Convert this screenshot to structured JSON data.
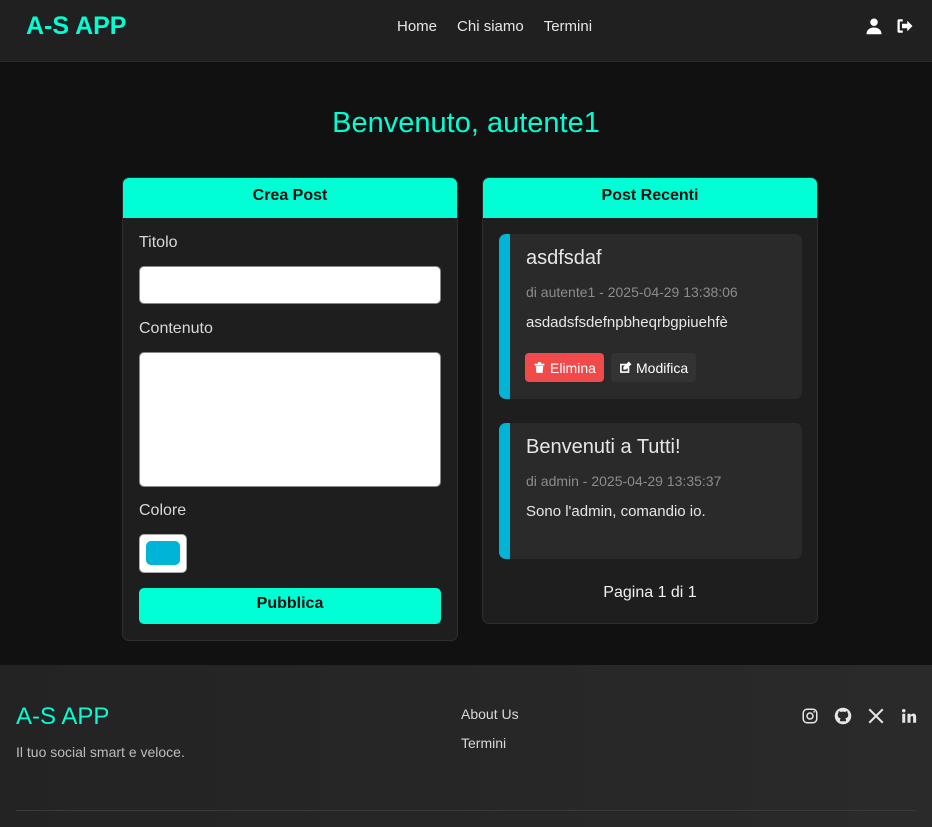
{
  "navbar": {
    "brand": "A-S APP",
    "links": [
      "Home",
      "Chi siamo",
      "Termini"
    ],
    "icons": [
      "user-icon",
      "logout-icon"
    ]
  },
  "welcome": "Benvenuto, autente1",
  "create_post": {
    "header": "Crea Post",
    "title_label": "Titolo",
    "title_value": "",
    "content_label": "Contenuto",
    "content_value": "",
    "color_label": "Colore",
    "color_value": "#00b4d8",
    "publish_label": "Pubblica"
  },
  "recent_posts": {
    "header": "Post Recenti",
    "posts": [
      {
        "title": "asdfsdaf",
        "meta": "di autente1 - 2025-04-29 13:38:06",
        "body": "asdadsfsdefnpbheqrbgpiuehfè",
        "delete_label": "Elimina",
        "edit_label": "Modifica"
      },
      {
        "title": "Benvenuti a Tutti!",
        "meta": "di admin - 2025-04-29 13:35:37",
        "body": "Sono l'admin, comandio io."
      }
    ],
    "pager": "Pagina 1 di 1"
  },
  "footer": {
    "brand": "A-S APP",
    "tagline": "Il tuo social smart e veloce.",
    "links": [
      "About Us",
      "Termini"
    ],
    "social": [
      "instagram-icon",
      "github-icon",
      "x-icon",
      "linkedin-icon"
    ]
  },
  "colors": {
    "accent": "#00ffd5",
    "post_border": "#00b4d8",
    "danger": "#f04a4a"
  }
}
